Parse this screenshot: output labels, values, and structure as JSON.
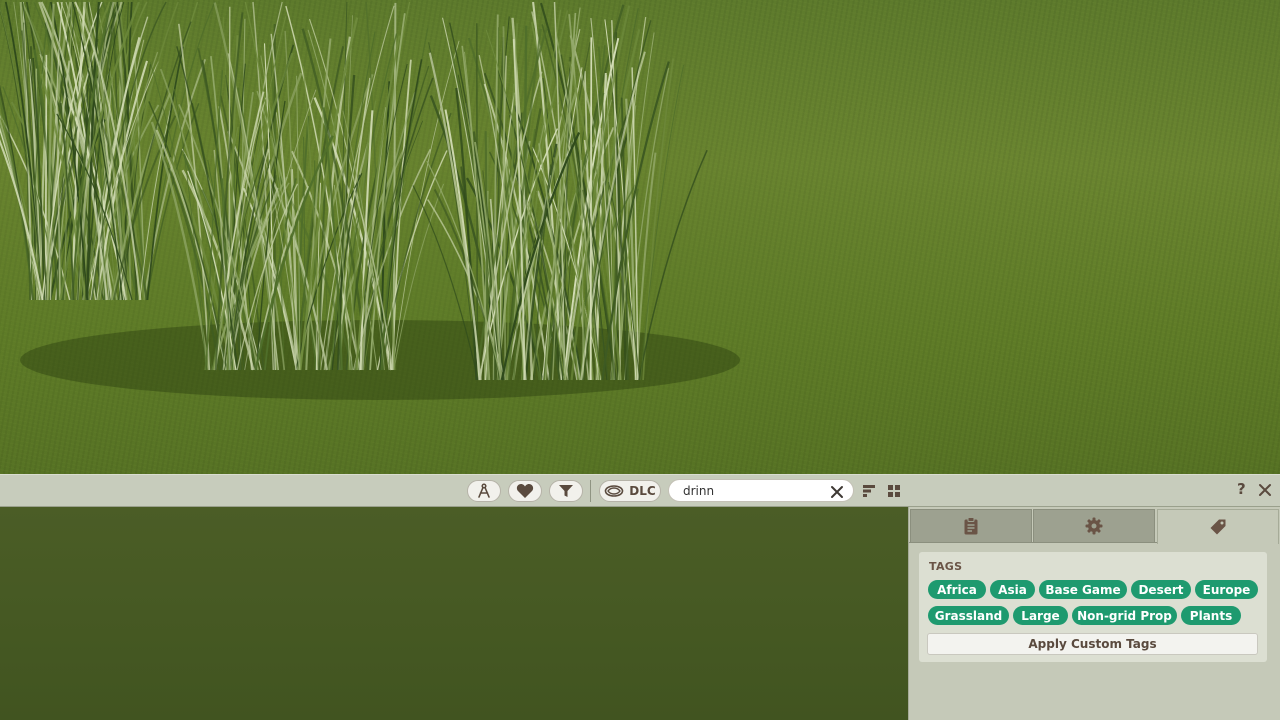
{
  "toolbar": {
    "buttons": [
      {
        "name": "compass-icon"
      },
      {
        "name": "heart-icon"
      },
      {
        "name": "filter-icon"
      }
    ],
    "dlc_label": "DLC",
    "search": {
      "value": "drinn",
      "placeholder": ""
    },
    "help_label": "?"
  },
  "panel": {
    "tabs": [
      {
        "name": "clipboard-icon",
        "active": false
      },
      {
        "name": "gear-icon",
        "active": false
      },
      {
        "name": "tag-icon",
        "active": true
      }
    ],
    "tags_title": "TAGS",
    "tags": [
      "Africa",
      "Asia",
      "Base Game",
      "Desert",
      "Europe",
      "Grassland",
      "Large",
      "Non-grid Prop",
      "Plants"
    ],
    "apply_label": "Apply Custom Tags"
  },
  "colors": {
    "tag_bg": "#1e9a6f",
    "toolbar_bg": "#c7ccbc",
    "panel_bg": "#c5c9b8",
    "icon_brown": "#5a4a3e"
  }
}
